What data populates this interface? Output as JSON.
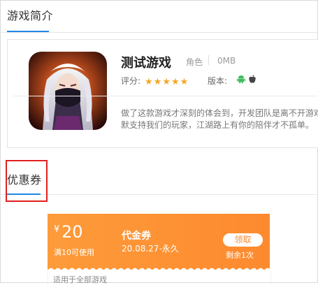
{
  "intro_section": {
    "title": "游戏简介"
  },
  "game": {
    "icon_name": "game-avatar-icon",
    "name": "测试游戏",
    "category": "角色",
    "size": "0MB",
    "rating_label": "评分:",
    "rating_stars": 5,
    "version_label": "版本:",
    "platforms": [
      "android-icon",
      "apple-icon"
    ],
    "description_line1": "做了这款游戏才深刻的体会到，开发团队是离不开游戏",
    "description_line2": "默支持我们的玩家，江湖路上有你的陪伴才不孤单。"
  },
  "coupon_section": {
    "title": "优惠券"
  },
  "coupon": {
    "currency": "¥",
    "amount": "20",
    "condition": "满10可使用",
    "type": "代金券",
    "validity": "20.08.27-永久",
    "claim_label": "领取",
    "remaining": "剩余1次",
    "scope": "适用于全部游戏"
  },
  "colors": {
    "accent_blue": "#1e88e5",
    "coupon_orange": "#fd8f33",
    "star": "#f5a623",
    "highlight_red": "#e02020",
    "android_green": "#3dbb5c"
  }
}
